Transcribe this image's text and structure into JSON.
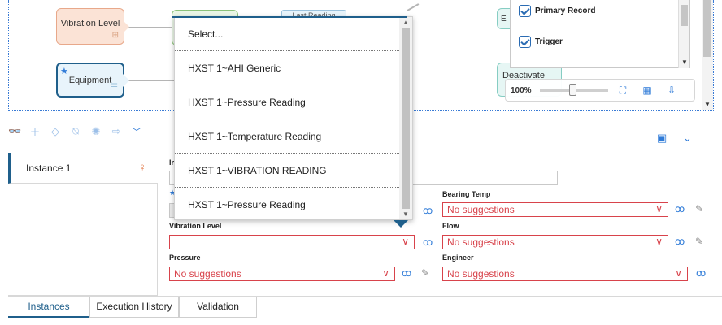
{
  "diagram": {
    "nodes": {
      "vibration_level": "Vibration Level",
      "equipment": "Equipment",
      "last_reading": "Last Reading",
      "deactivate": "Deactivate",
      "e_node": "E"
    }
  },
  "trigger_panel": {
    "items": [
      {
        "label": "Primary Record",
        "checked": true
      },
      {
        "label": "Trigger",
        "checked": true
      }
    ]
  },
  "zoom": {
    "level": "100%"
  },
  "instances": {
    "items": [
      {
        "label": "Instance 1"
      }
    ]
  },
  "form": {
    "fields": {
      "bearing_temp": {
        "label": "Bearing Temp",
        "value": "No suggestions"
      },
      "vibration_level": {
        "label": "Vibration Level",
        "value": ""
      },
      "flow": {
        "label": "Flow",
        "value": "No suggestions"
      },
      "pressure": {
        "label": "Pressure",
        "value": "No suggestions"
      },
      "engineer": {
        "label": "Engineer",
        "value": "No suggestions"
      }
    },
    "clipped_label_1": "In",
    "clipped_label_2": "I"
  },
  "dropdown": {
    "options": [
      "Select...",
      "HXST 1~AHI Generic",
      "HXST 1~Pressure Reading",
      "HXST 1~Temperature Reading",
      "HXST 1~VIBRATION READING",
      "HXST 1~Pressure Reading"
    ]
  },
  "tabs": [
    {
      "label": "Instances",
      "active": true
    },
    {
      "label": "Execution History",
      "active": false
    },
    {
      "label": "Validation",
      "active": false
    }
  ],
  "colors": {
    "accent": "#2f7bd8",
    "primary_dark": "#1f5f8b",
    "error": "#d8434b"
  }
}
